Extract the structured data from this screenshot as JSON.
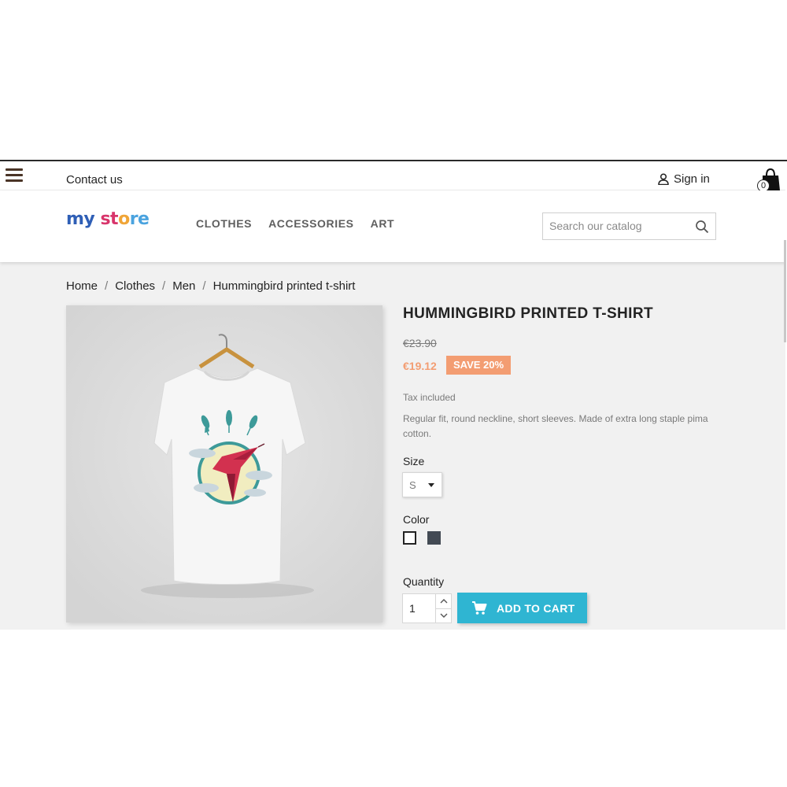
{
  "topbar": {
    "contact_label": "Contact us",
    "signin_label": "Sign in",
    "cart_count": "0"
  },
  "header": {
    "logo": {
      "part1": "my",
      "part2": "st",
      "part3": "o",
      "part4": "re"
    },
    "nav": [
      "CLOTHES",
      "ACCESSORIES",
      "ART"
    ],
    "search_placeholder": "Search our catalog"
  },
  "breadcrumb": [
    "Home",
    "Clothes",
    "Men",
    "Hummingbird printed t-shirt"
  ],
  "product": {
    "title": "HUMMINGBIRD PRINTED T-SHIRT",
    "old_price": "€23.90",
    "price": "€19.12",
    "discount": "SAVE 20%",
    "tax": "Tax included",
    "description": "Regular fit, round neckline, short sleeves. Made of extra long staple pima cotton.",
    "size_label": "Size",
    "size_value": "S",
    "color_label": "Color",
    "colors": [
      "#ffffff",
      "#434a54"
    ],
    "quantity_label": "Quantity",
    "quantity_value": "1",
    "add_to_cart": "ADD TO CART"
  },
  "colors": {
    "accent": "#2fb5d2",
    "discount": "#f39d72"
  }
}
